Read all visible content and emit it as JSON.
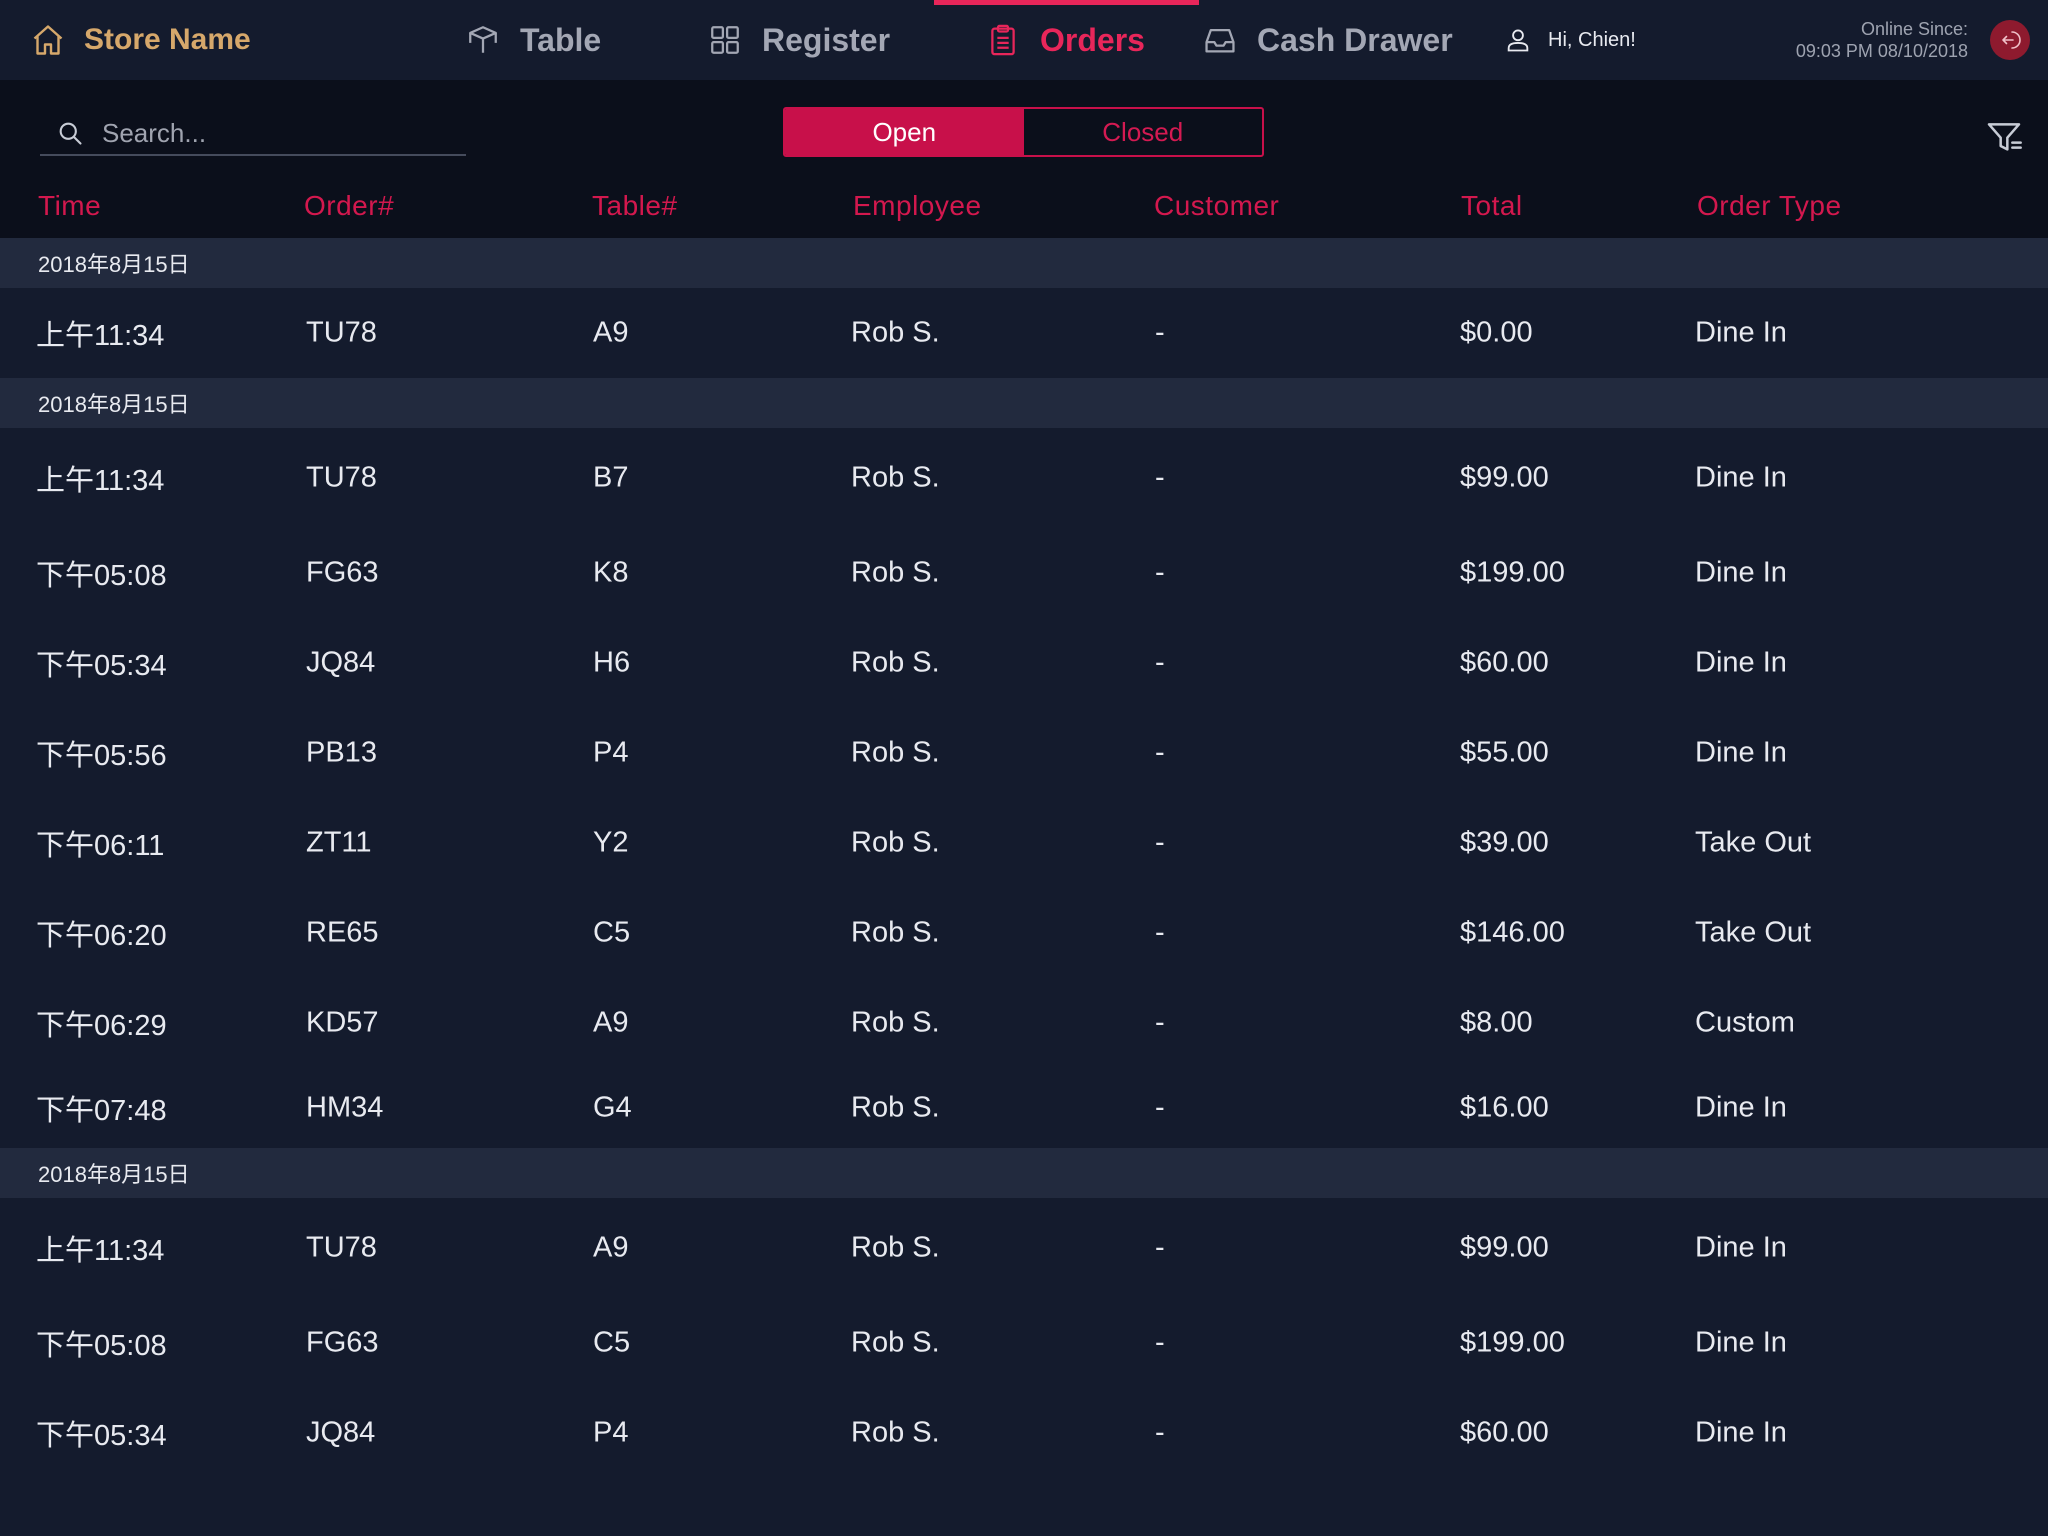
{
  "header": {
    "store_name": "Store Name",
    "tabs": [
      {
        "label": "Table",
        "icon": "table-icon"
      },
      {
        "label": "Register",
        "icon": "grid-icon"
      },
      {
        "label": "Orders",
        "icon": "clipboard-icon",
        "active": true
      },
      {
        "label": "Cash Drawer",
        "icon": "inbox-icon"
      }
    ],
    "greeting": "Hi, Chien!",
    "online_label": "Online Since:",
    "online_value": "09:03 PM 08/10/2018"
  },
  "toolbar": {
    "search_placeholder": "Search...",
    "segments": [
      "Open",
      "Closed"
    ],
    "selected_segment": "Open"
  },
  "columns": [
    "Time",
    "Order#",
    "Table#",
    "Employee",
    "Customer",
    "Total",
    "Order Type"
  ],
  "groups": [
    {
      "date": "2018年8月15日",
      "rows": [
        {
          "time": "上午11:34",
          "order": "TU78",
          "table": "A9",
          "employee": "Rob S.",
          "customer": "-",
          "total": "$0.00",
          "type": "Dine In"
        }
      ]
    },
    {
      "date": "2018年8月15日",
      "rows": [
        {
          "time": "上午11:34",
          "order": "TU78",
          "table": "B7",
          "employee": "Rob S.",
          "customer": "-",
          "total": "$99.00",
          "type": "Dine In"
        },
        {
          "time": "下午05:08",
          "order": "FG63",
          "table": "K8",
          "employee": "Rob S.",
          "customer": "-",
          "total": "$199.00",
          "type": "Dine In"
        },
        {
          "time": "下午05:34",
          "order": "JQ84",
          "table": "H6",
          "employee": "Rob S.",
          "customer": "-",
          "total": "$60.00",
          "type": "Dine In"
        },
        {
          "time": "下午05:56",
          "order": "PB13",
          "table": "P4",
          "employee": "Rob S.",
          "customer": "-",
          "total": "$55.00",
          "type": "Dine In"
        },
        {
          "time": "下午06:11",
          "order": "ZT11",
          "table": "Y2",
          "employee": "Rob S.",
          "customer": "-",
          "total": "$39.00",
          "type": "Take Out"
        },
        {
          "time": "下午06:20",
          "order": "RE65",
          "table": "C5",
          "employee": "Rob S.",
          "customer": "-",
          "total": "$146.00",
          "type": "Take Out"
        },
        {
          "time": "下午06:29",
          "order": "KD57",
          "table": "A9",
          "employee": "Rob S.",
          "customer": "-",
          "total": "$8.00",
          "type": "Custom"
        },
        {
          "time": "下午07:48",
          "order": "HM34",
          "table": "G4",
          "employee": "Rob S.",
          "customer": "-",
          "total": "$16.00",
          "type": "Dine In"
        }
      ]
    },
    {
      "date": "2018年8月15日",
      "rows": [
        {
          "time": "上午11:34",
          "order": "TU78",
          "table": "A9",
          "employee": "Rob S.",
          "customer": "-",
          "total": "$99.00",
          "type": "Dine In"
        },
        {
          "time": "下午05:08",
          "order": "FG63",
          "table": "C5",
          "employee": "Rob S.",
          "customer": "-",
          "total": "$199.00",
          "type": "Dine In"
        },
        {
          "time": "下午05:34",
          "order": "JQ84",
          "table": "P4",
          "employee": "Rob S.",
          "customer": "-",
          "total": "$60.00",
          "type": "Dine In"
        }
      ]
    }
  ],
  "colors": {
    "accent": "#e8265a",
    "brand": "#d6a86b",
    "background": "#141b2d",
    "group_header": "#222a3e"
  }
}
